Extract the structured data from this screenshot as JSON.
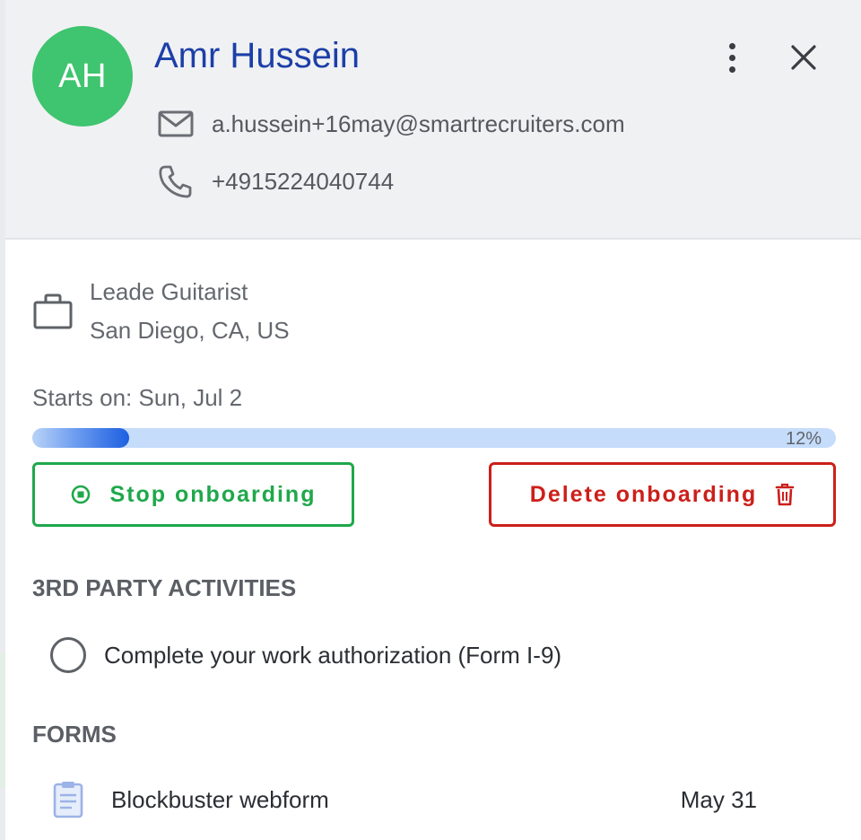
{
  "candidate": {
    "initials": "AH",
    "name": "Amr Hussein",
    "email": "a.hussein+16may@smartrecruiters.com",
    "phone": "+4915224040744",
    "avatar_color": "#3fc46f"
  },
  "job": {
    "title": "Leade Guitarist",
    "location": "San Diego, CA, US"
  },
  "onboarding": {
    "starts_on": "Starts on: Sun, Jul 2",
    "progress_percent": 12,
    "progress_label": "12%",
    "stop_label": "Stop onboarding",
    "delete_label": "Delete onboarding"
  },
  "third_party": {
    "heading": "3RD PARTY ACTIVITIES",
    "items": [
      {
        "label": "Complete your work authorization (Form I-9)",
        "completed": false
      }
    ]
  },
  "forms": {
    "heading": "FORMS",
    "items": [
      {
        "name": "Blockbuster webform",
        "date": "May 31"
      }
    ]
  },
  "icons": {
    "more": "kebab-menu-icon",
    "close": "close-icon",
    "email": "envelope-icon",
    "phone": "phone-icon",
    "job": "briefcase-icon",
    "stop": "stop-circle-icon",
    "delete": "trash-icon",
    "form": "clipboard-icon"
  },
  "colors": {
    "name_link": "#1c3fa8",
    "stop_green": "#1fa84b",
    "delete_red": "#cc1f1a",
    "progress_track": "#c5dcfb",
    "progress_fill": "#1d5fe0"
  }
}
